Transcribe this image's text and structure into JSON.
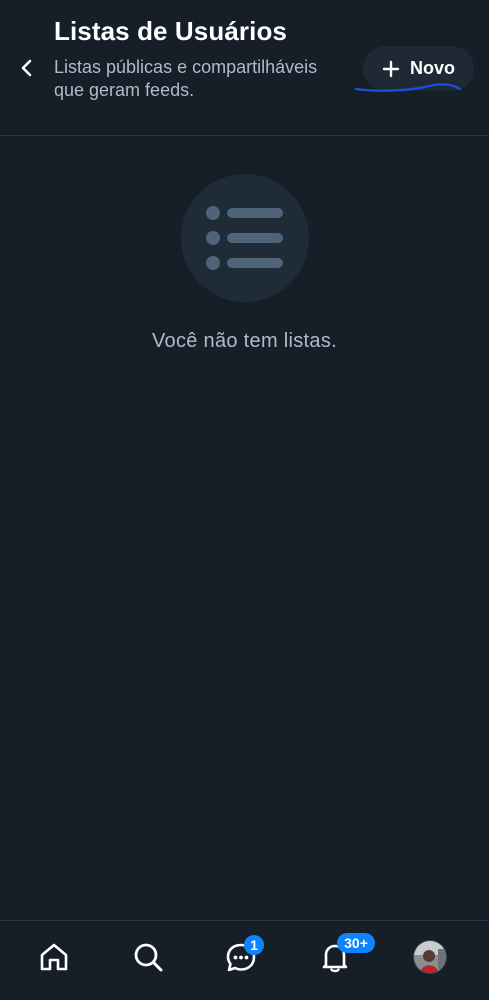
{
  "header": {
    "title": "Listas de Usuários",
    "subtitle": "Listas públicas e compartilháveis que geram feeds.",
    "new_button_label": "Novo"
  },
  "empty_state": {
    "message": "Você não tem listas."
  },
  "bottom_nav": {
    "items": [
      {
        "name": "home",
        "icon": "home-icon"
      },
      {
        "name": "search",
        "icon": "search-icon"
      },
      {
        "name": "chat",
        "icon": "chat-icon",
        "badge": "1"
      },
      {
        "name": "notifications",
        "icon": "bell-icon",
        "badge": "30+"
      },
      {
        "name": "profile",
        "icon": "avatar"
      }
    ]
  },
  "colors": {
    "background": "#161e27",
    "accent": "#1083fe",
    "muted_text": "#aebbc9",
    "button_bg": "#1e2935",
    "annotation": "#1f4fd6"
  }
}
